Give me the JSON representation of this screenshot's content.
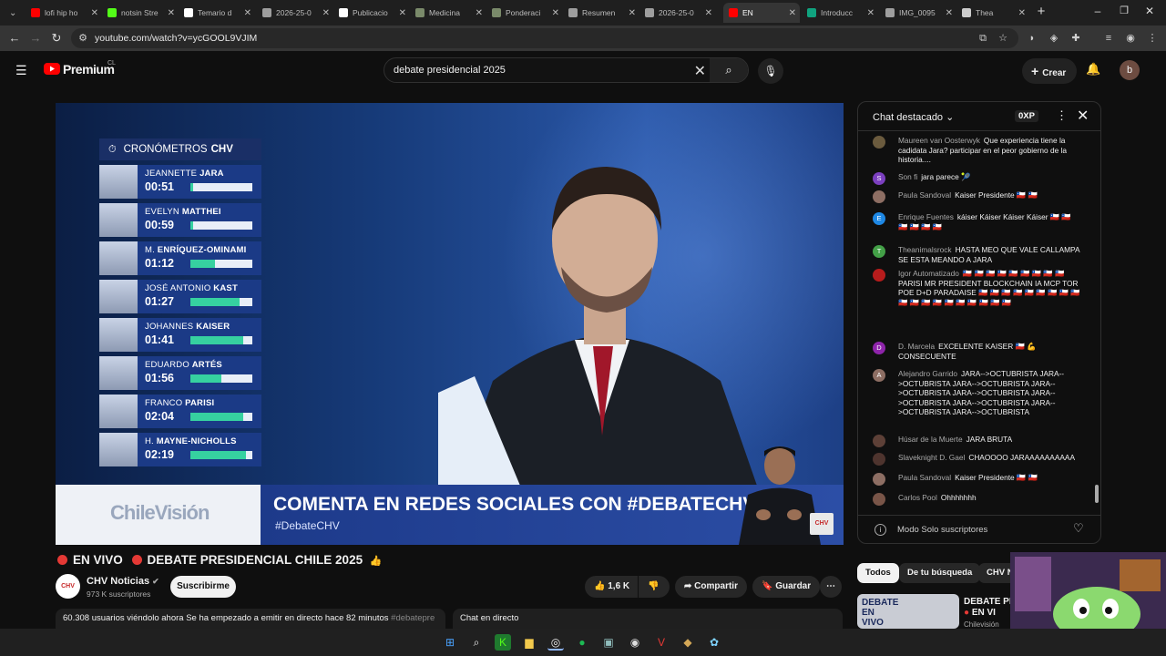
{
  "browser": {
    "tabs": [
      {
        "title": "lofi hip ho",
        "color": "#ff0000"
      },
      {
        "title": "notsin Stre",
        "color": "#53fc18"
      },
      {
        "title": "Temario d",
        "color": "#ffffff"
      },
      {
        "title": "2026-25-0",
        "color": "#9e9e9e"
      },
      {
        "title": "Publicacio",
        "color": "#ffffff"
      },
      {
        "title": "Medicina",
        "color": "#7a8a6a"
      },
      {
        "title": "Ponderaci",
        "color": "#7a8a6a"
      },
      {
        "title": "Resumen",
        "color": "#9e9e9e"
      },
      {
        "title": "2026-25-0",
        "color": "#9e9e9e"
      },
      {
        "title": "EN",
        "color": "#ff0000"
      },
      {
        "title": "Introducc",
        "color": "#10a37f"
      },
      {
        "title": "IMG_0095",
        "color": "#9e9e9e"
      },
      {
        "title": "Thea",
        "color": "#cccccc"
      }
    ],
    "url": "youtube.com/watch?v=ycGOOL9VJIM"
  },
  "youtube": {
    "logo": "Premium",
    "country": "CL",
    "search_value": "debate presidencial 2025",
    "create_label": "Crear",
    "avatar_letter": "b"
  },
  "video": {
    "chrono_title_a": "CRONÓMETROS",
    "chrono_title_b": "CHV",
    "candidates": [
      {
        "first": "JEANNETTE",
        "last": "JARA",
        "time": "00:51",
        "fill": 0.05
      },
      {
        "first": "EVELYN",
        "last": "MATTHEI",
        "time": "00:59",
        "fill": 0.05
      },
      {
        "first": "M.",
        "last": "ENRÍQUEZ-OMINAMI",
        "time": "01:12",
        "fill": 0.4
      },
      {
        "first": "JOSÉ ANTONIO",
        "last": "KAST",
        "time": "01:27",
        "fill": 0.8
      },
      {
        "first": "JOHANNES",
        "last": "KAISER",
        "time": "01:41",
        "fill": 0.85
      },
      {
        "first": "EDUARDO",
        "last": "ARTÉS",
        "time": "01:56",
        "fill": 0.5
      },
      {
        "first": "FRANCO",
        "last": "PARISI",
        "time": "02:04",
        "fill": 0.85
      },
      {
        "first": "H.",
        "last": "MAYNE-NICHOLLS",
        "time": "02:19",
        "fill": 0.9
      }
    ],
    "lower_third_logo": "ChileVisión",
    "lower_third_main": "COMENTA EN REDES SOCIALES CON #DEBATECHV",
    "lower_third_sub": "#DebateCHV",
    "bug": "CHV"
  },
  "below_video": {
    "live_label": "EN VIVO",
    "title": "DEBATE PRESIDENCIAL CHILE 2025",
    "channel_name": "CHV Noticias",
    "channel_logo": "CHV",
    "subscribers": "973 K suscriptores",
    "subscribe_label": "Suscribirme",
    "likes": "1,6 K",
    "share_label": "Compartir",
    "save_label": "Guardar",
    "description": "60.308 usuarios viéndolo ahora  Se ha empezado a emitir en directo hace 82 minutos",
    "description_tag": "#debatepre",
    "chat_replay_label": "Chat en directo"
  },
  "chat": {
    "title": "Chat destacado",
    "xp": "0XP",
    "messages": [
      {
        "author": "Maureen van Oosterwyk",
        "text": "Que experiencia tiene la cadidata Jara? participar en el peor gobierno de la historia....",
        "avatar": "",
        "avatar_color": "#6b5b3e"
      },
      {
        "author": "Son fi",
        "text": "jara parece 🎾",
        "avatar": "S",
        "avatar_color": "#7b3fbf"
      },
      {
        "author": "Paula Sandoval",
        "text": "Kaiser Presidente 🇨🇱 🇨🇱",
        "avatar": "",
        "avatar_color": "#8d6e63"
      },
      {
        "author": "Enrique Fuentes",
        "text": "káiser Káiser Káiser Káiser 🇨🇱 🇨🇱 🇨🇱 🇨🇱 🇨🇱 🇨🇱",
        "avatar": "E",
        "avatar_color": "#1e88e5"
      },
      {
        "author": "Theanimalsrock",
        "text": "HASTA MEO QUE VALE CALLAMPA SE ESTA MEANDO A JARA",
        "avatar": "T",
        "avatar_color": "#43a047"
      },
      {
        "author": "Igor Automatizado",
        "text": "🇨🇱 🇨🇱 🇨🇱 🇨🇱 🇨🇱 🇨🇱 🇨🇱 🇨🇱 🇨🇱 PARISI MR PRESIDENT BLOCKCHAIN IA MCP TOR POE D+D PARADAISE 🇨🇱 🇨🇱 🇨🇱 🇨🇱 🇨🇱 🇨🇱 🇨🇱 🇨🇱 🇨🇱 🇨🇱 🇨🇱 🇨🇱 🇨🇱 🇨🇱 🇨🇱 🇨🇱 🇨🇱 🇨🇱 🇨🇱",
        "avatar": "",
        "avatar_color": "#b71c1c"
      },
      {
        "author": "D. Marcela",
        "text": "EXCELENTE KAISER 🇨🇱 💪 CONSECUENTE",
        "avatar": "D",
        "avatar_color": "#8e24aa"
      },
      {
        "author": "Alejandro Garrido",
        "text": "JARA-->OCTUBRISTA JARA-->OCTUBRISTA JARA-->OCTUBRISTA JARA-->OCTUBRISTA JARA-->OCTUBRISTA JARA-->OCTUBRISTA JARA-->OCTUBRISTA JARA-->OCTUBRISTA JARA-->OCTUBRISTA",
        "avatar": "A",
        "avatar_color": "#8d6e63"
      },
      {
        "author": "Húsar de la Muerte",
        "text": "JARA BRUTA",
        "avatar": "",
        "avatar_color": "#5d4037"
      },
      {
        "author": "Slaveknight D. Gael",
        "text": "CHAOOOO JARAAAAAAAAAA",
        "avatar": "",
        "avatar_color": "#4e342e"
      },
      {
        "author": "Paula Sandoval",
        "text": "Kaiser Presidente 🇨🇱 🇨🇱",
        "avatar": "",
        "avatar_color": "#8d6e63"
      },
      {
        "author": "Carlos Pool",
        "text": "Ohhhhhhh",
        "avatar": "",
        "avatar_color": "#795548"
      }
    ],
    "footer": "Modo Solo suscriptores"
  },
  "sidebar": {
    "chips": [
      "Todos",
      "De tu búsqueda",
      "CHV N"
    ],
    "rec_thumb_text": "DEBATE EN VIVO",
    "rec_title_line1": "DEBATE PRE",
    "rec_title_line2": "EN VI",
    "rec_channel": "Chilevisión"
  }
}
